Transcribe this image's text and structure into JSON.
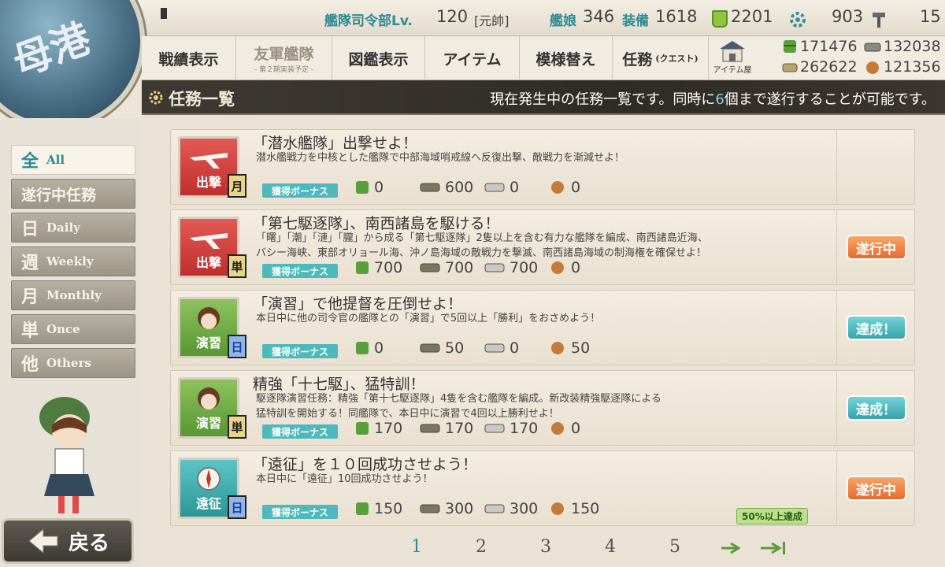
{
  "top": {
    "hq_label": "艦隊司令部Lv.",
    "level": "120",
    "rank": "[元帥]",
    "ships_label": "艦娘",
    "ships": "346",
    "equip_label": "装備",
    "equip": "1618",
    "bucket": "2201",
    "dev_mat": "903",
    "screw": "15"
  },
  "menu": [
    {
      "label": "戦績表示",
      "sub": "",
      "disabled": false
    },
    {
      "label": "友軍艦隊",
      "sub": "- 第２期実装予定 -",
      "disabled": true
    },
    {
      "label": "図鑑表示",
      "sub": "",
      "disabled": false
    },
    {
      "label": "アイテム",
      "sub": "",
      "disabled": false
    },
    {
      "label": "模様替え",
      "sub": "",
      "disabled": false
    },
    {
      "label": "任務",
      "sub": "(クエスト)",
      "disabled": false
    }
  ],
  "item_shop_label": "アイテム屋",
  "resources": {
    "fuel": "171476",
    "ammo": "132038",
    "steel": "262622",
    "bauxite": "121356"
  },
  "header": {
    "title": "任務一覧",
    "note_before": "現在発生中の任務一覧です。同時に",
    "note_num": "6",
    "note_after": "個まで遂行することが可能です。"
  },
  "sidebar": [
    {
      "big": "全",
      "small": "All",
      "active": true
    },
    {
      "big": "遂行中任務",
      "small": "",
      "active": false
    },
    {
      "big": "日",
      "small": "Daily",
      "active": false
    },
    {
      "big": "週",
      "small": "Weekly",
      "active": false
    },
    {
      "big": "月",
      "small": "Monthly",
      "active": false
    },
    {
      "big": "単",
      "small": "Once",
      "active": false
    },
    {
      "big": "他",
      "small": "Others",
      "active": false
    }
  ],
  "back_label": "戻る",
  "bonus_label": "獲得ボーナス",
  "quests": [
    {
      "title": "「潜水艦隊」出撃せよ！",
      "desc1": "潜水艦戦力を中核とした艦隊で中部海域哨戒線へ反復出撃、敵戦力を漸減せよ！",
      "desc2": "",
      "cat": "出撃",
      "color": "red",
      "type": "月",
      "res": [
        "0",
        "600",
        "0",
        "0"
      ],
      "status": "",
      "note": ""
    },
    {
      "title": "「第七駆逐隊」、南西諸島を駆ける！",
      "desc1": "「曙」「潮」「漣」「朧」から成る「第七駆逐隊」2隻以上を含む有力な艦隊を編成、南西諸島近海、",
      "desc2": "バシー海峡、東部オリョール海、沖ノ島海域の敵戦力を撃滅、南西諸島海域の制海権を確保せよ！",
      "cat": "出撃",
      "color": "red",
      "type": "単",
      "res": [
        "700",
        "700",
        "700",
        "0"
      ],
      "status": "遂行中",
      "note": ""
    },
    {
      "title": "「演習」で他提督を圧倒せよ！",
      "desc1": "本日中に他の司令官の艦隊との「演習」で5回以上「勝利」をおさめよう！",
      "desc2": "",
      "cat": "演習",
      "color": "green",
      "type": "日",
      "res": [
        "0",
        "50",
        "0",
        "50"
      ],
      "status": "達成！",
      "note": ""
    },
    {
      "title": "精強「十七駆」、猛特訓！",
      "desc1": "駆逐隊演習任務：精強「第十七駆逐隊」4隻を含む艦隊を編成。新改装精強駆逐隊による",
      "desc2": "猛特訓を開始する！同艦隊で、本日中に演習で4回以上勝利せよ！",
      "cat": "演習",
      "color": "green",
      "type": "単",
      "res": [
        "170",
        "170",
        "170",
        "0"
      ],
      "status": "達成！",
      "note": ""
    },
    {
      "title": "「遠征」を１０回成功させよう！",
      "desc1": "本日中に「遠征」10回成功させよう！",
      "desc2": "",
      "cat": "遠征",
      "color": "teal",
      "type": "日",
      "res": [
        "150",
        "300",
        "300",
        "150"
      ],
      "status": "遂行中",
      "note": "50%以上達成"
    }
  ],
  "pages": [
    "1",
    "2",
    "3",
    "4",
    "5"
  ],
  "current_page": "1",
  "colors": {
    "accent": "#2e8a94",
    "progress": "#e86a30",
    "done": "#39a3a8"
  }
}
